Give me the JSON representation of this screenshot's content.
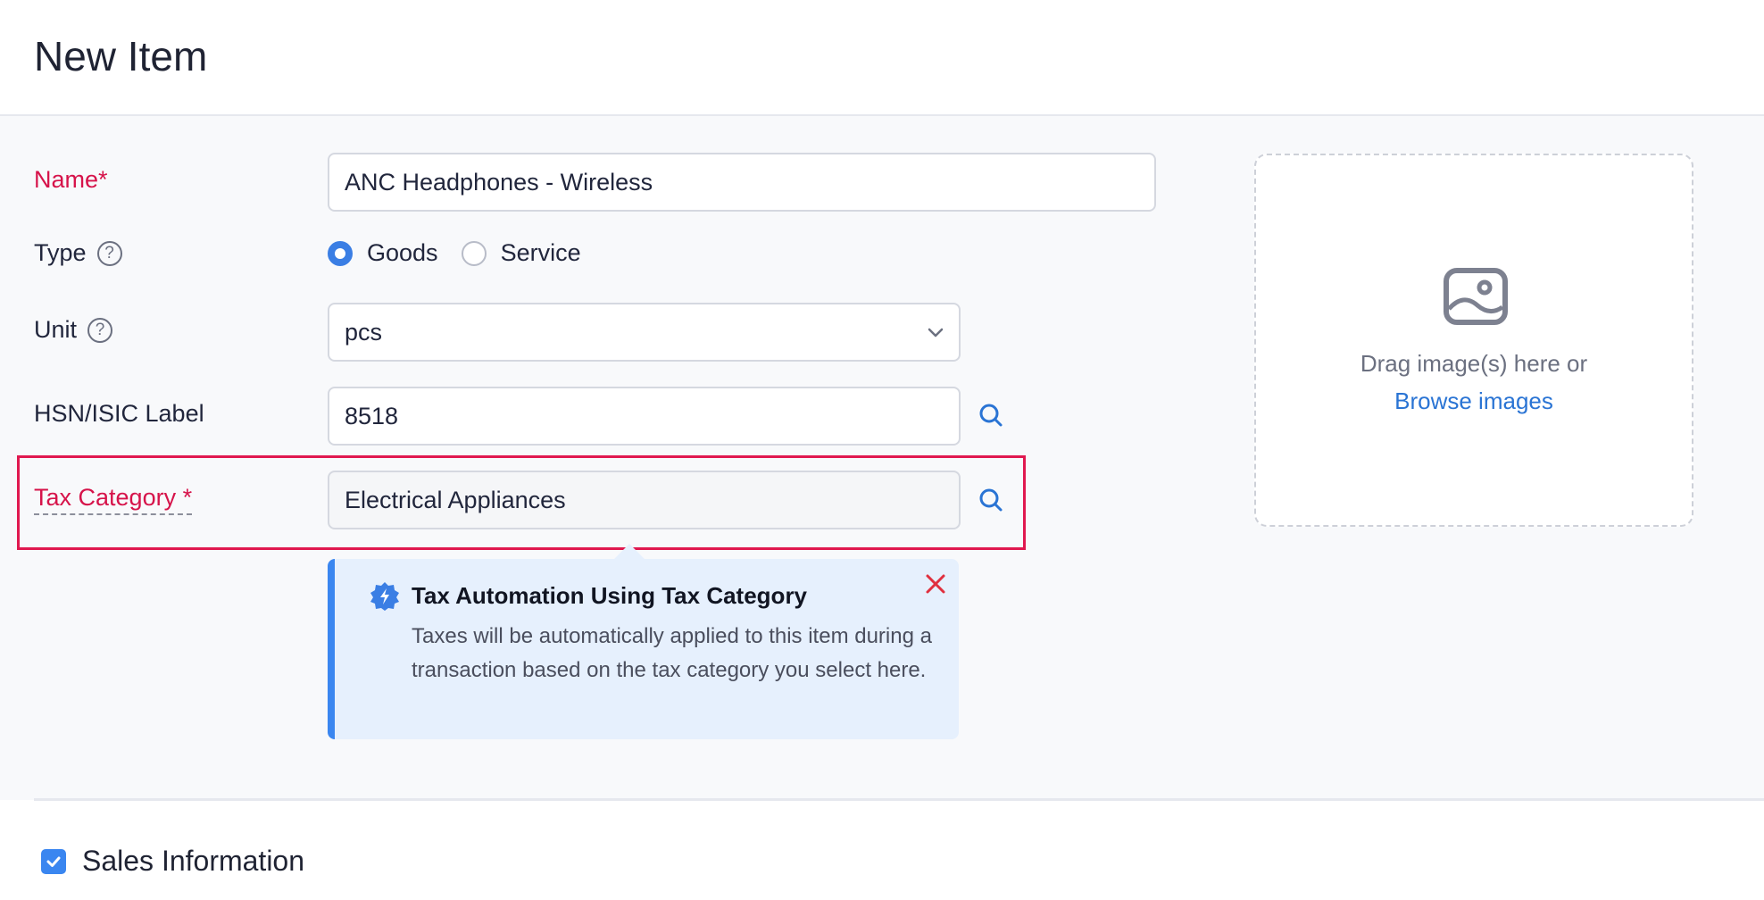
{
  "page": {
    "title": "New Item"
  },
  "form": {
    "name": {
      "label": "Name*",
      "value": "ANC Headphones - Wireless"
    },
    "type": {
      "label": "Type",
      "options": [
        "Goods",
        "Service"
      ],
      "selected": "Goods"
    },
    "unit": {
      "label": "Unit",
      "value": "pcs"
    },
    "hsn": {
      "label": "HSN/ISIC Label",
      "value": "8518"
    },
    "tax_category": {
      "label": "Tax Category",
      "required_mark": "*",
      "value": "Electrical Appliances"
    }
  },
  "info_card": {
    "title": "Tax Automation Using Tax Category",
    "body": "Taxes will be automatically applied to this item during a transaction based on the tax category you select here."
  },
  "image_upload": {
    "drag_text": "Drag image(s) here or",
    "browse_link": "Browse images"
  },
  "sales": {
    "label": "Sales Information",
    "checked": true
  },
  "colors": {
    "accent": "#3a7ee4",
    "required": "#d6134a",
    "highlight_border": "#e0184f",
    "info_bg": "#e6f0fd",
    "link": "#2a74d4"
  },
  "icons": [
    "help-icon",
    "chevron-down-icon",
    "search-icon",
    "settings-bolt-icon",
    "close-icon",
    "image-icon",
    "checkmark-icon"
  ]
}
